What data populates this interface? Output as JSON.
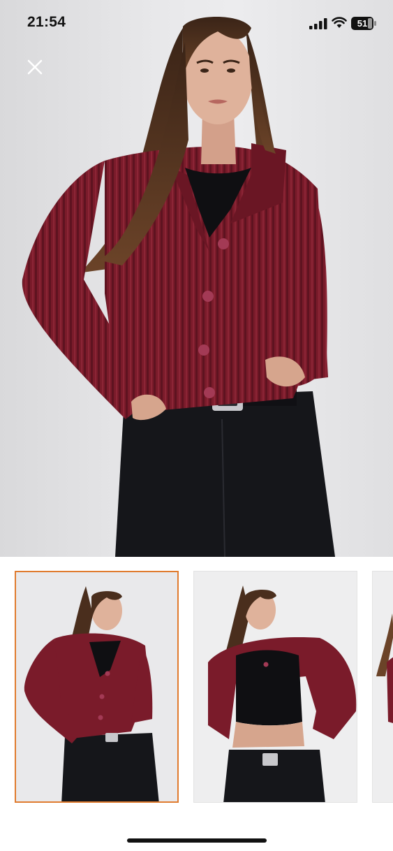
{
  "status_bar": {
    "time": "21:54",
    "battery_level": "51",
    "icons": [
      "signal-icon",
      "wifi-icon",
      "battery-icon"
    ]
  },
  "gallery": {
    "close_icon": "close-icon",
    "selected_index": 0,
    "thumbnails": [
      {
        "name": "thumbnail-1"
      },
      {
        "name": "thumbnail-2"
      },
      {
        "name": "thumbnail-3"
      }
    ]
  },
  "colors": {
    "cardigan": "#7a1b2a",
    "jeans": "#15161a",
    "selected_border": "#e07b2e",
    "background": "#ffffff"
  }
}
